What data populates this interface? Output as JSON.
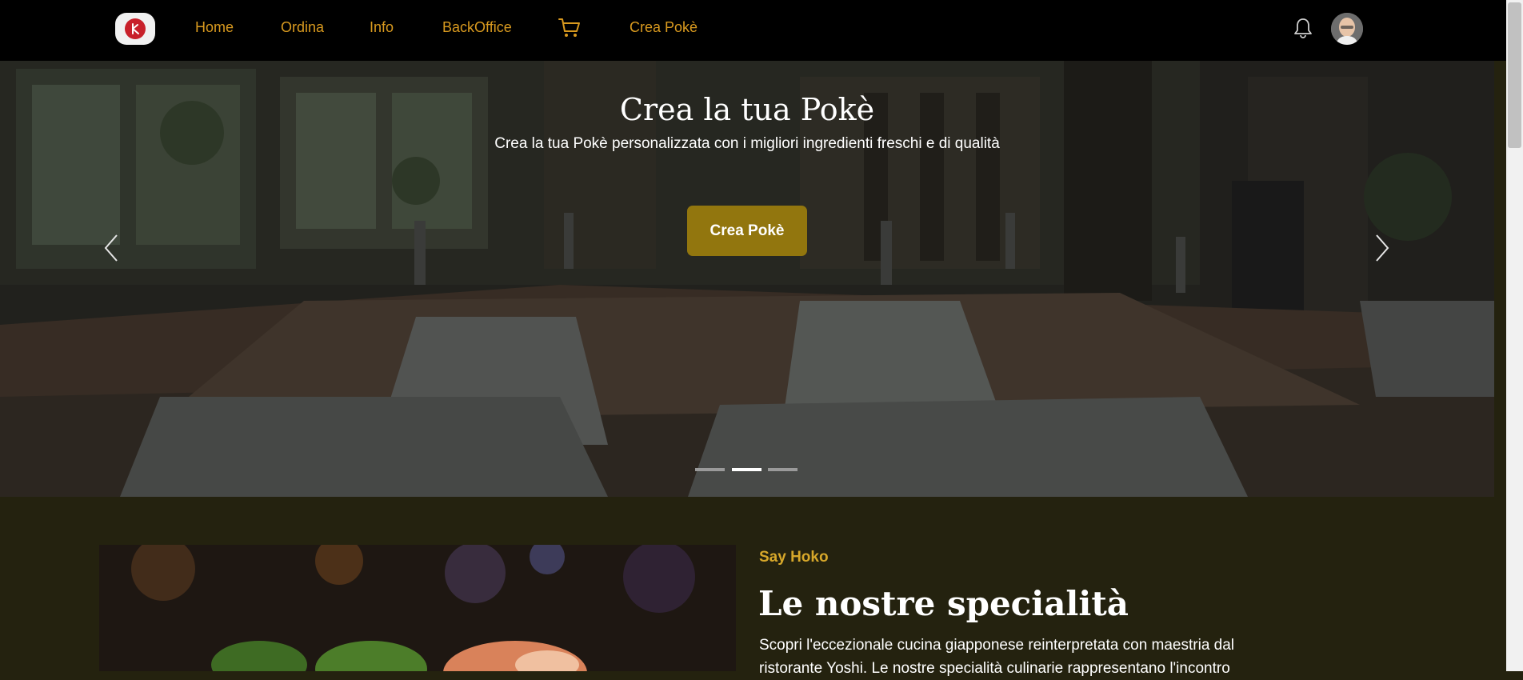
{
  "navbar": {
    "logo_alt": "logo",
    "links": [
      "Home",
      "Ordina",
      "Info",
      "BackOffice",
      "Crea Pokè"
    ],
    "cart_icon": "cart-icon",
    "bell_icon": "bell-icon",
    "accent_color": "#d99a1f"
  },
  "hero": {
    "title": "Crea la tua Pokè",
    "subtitle": "Crea la tua Pokè personalizzata con i migliori ingredienti freschi e di qualità",
    "cta_label": "Crea Pokè",
    "cta_color": "#92760e",
    "active_slide": 2,
    "slide_count": 3
  },
  "section": {
    "eyebrow": "Say Hoko",
    "title": "Le nostre specialità",
    "body": "Scopri l'eccezionale cucina giapponese reinterpretata con maestria dal ristorante Yoshi. Le nostre specialità culinarie rappresentano l'incontro"
  }
}
